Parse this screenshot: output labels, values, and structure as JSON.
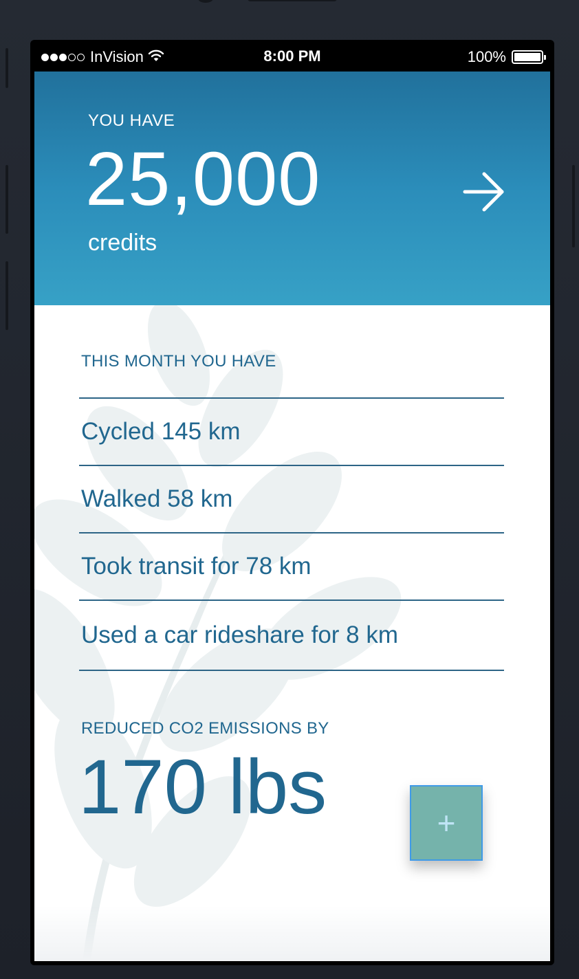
{
  "status_bar": {
    "carrier": "InVision",
    "time": "8:00 PM",
    "battery_percent": "100%",
    "signal_bars_filled": 3,
    "signal_bars_total": 5
  },
  "header": {
    "label": "YOU HAVE",
    "amount": "25,000",
    "unit": "credits",
    "arrow_icon": "arrow-right-icon"
  },
  "activity": {
    "label": "THIS MONTH YOU HAVE",
    "items": [
      {
        "text": "Cycled 145 km"
      },
      {
        "text": "Walked 58 km"
      },
      {
        "text": "Took transit for 78 km"
      },
      {
        "text": "Used a car rideshare for 8 km"
      }
    ]
  },
  "emissions": {
    "label": "REDUCED CO2 EMISSIONS BY",
    "value": "170 lbs"
  },
  "fab": {
    "label": "+",
    "icon": "plus-icon"
  },
  "colors": {
    "header_top": "#21719c",
    "header_bottom": "#37a1c6",
    "text_primary": "#21678f",
    "fab_background": "#75b3ab",
    "fab_border": "#3f9ae8"
  }
}
